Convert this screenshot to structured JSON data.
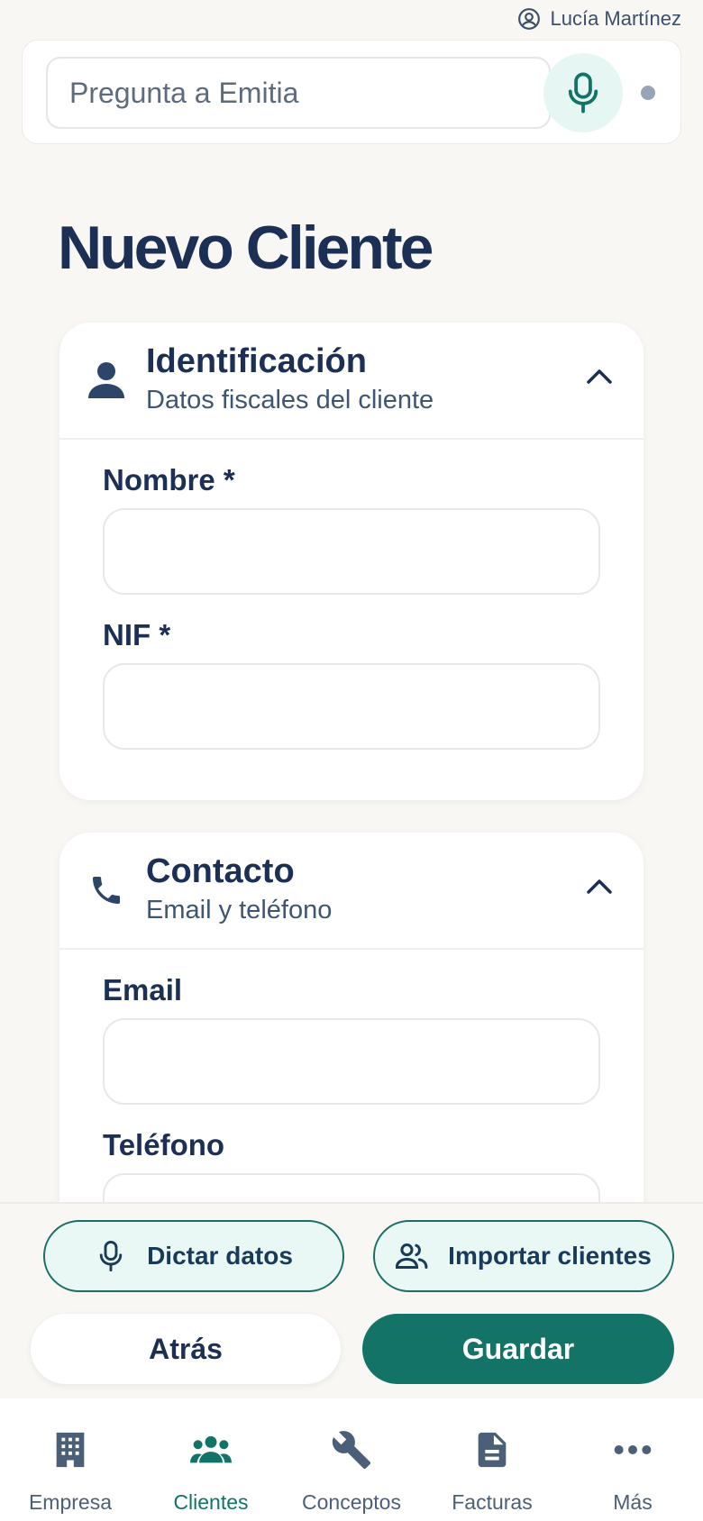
{
  "header": {
    "user_name": "Lucía Martínez"
  },
  "assistant": {
    "placeholder": "Pregunta a Emitia"
  },
  "page": {
    "title": "Nuevo Cliente"
  },
  "sections": {
    "identification": {
      "title": "Identificación",
      "subtitle": "Datos fiscales del cliente",
      "fields": {
        "name_label": "Nombre *",
        "name_value": "",
        "nif_label": "NIF *",
        "nif_value": ""
      }
    },
    "contact": {
      "title": "Contacto",
      "subtitle": "Email y teléfono",
      "fields": {
        "email_label": "Email",
        "email_value": "",
        "phone_label": "Teléfono",
        "phone_value": ""
      }
    }
  },
  "actions": {
    "dictate": "Dictar datos",
    "import": "Importar clientes",
    "back": "Atrás",
    "save": "Guardar"
  },
  "tabs": [
    {
      "label": "Empresa",
      "icon": "building-icon",
      "active": false
    },
    {
      "label": "Clientes",
      "icon": "users-icon",
      "active": true
    },
    {
      "label": "Conceptos",
      "icon": "wrench-icon",
      "active": false
    },
    {
      "label": "Facturas",
      "icon": "document-icon",
      "active": false
    },
    {
      "label": "Más",
      "icon": "more-icon",
      "active": false
    }
  ],
  "colors": {
    "accent": "#137367",
    "accent_light": "#e9f8f4",
    "text_primary": "#1c2f55",
    "background": "#f8f7f4"
  }
}
